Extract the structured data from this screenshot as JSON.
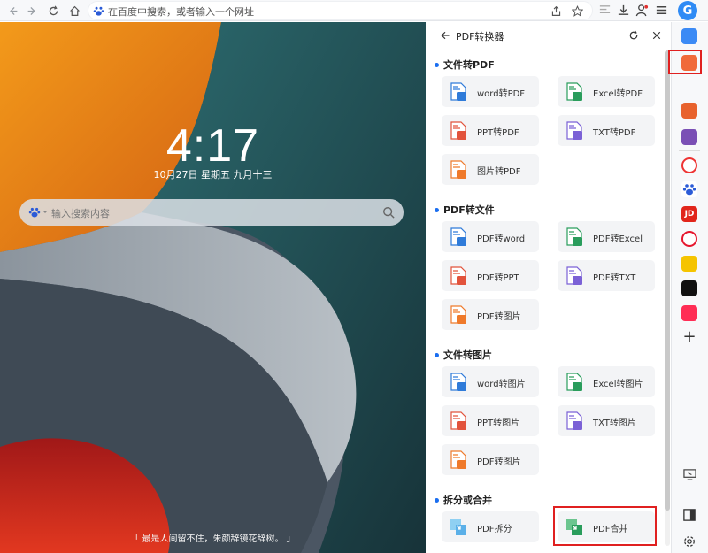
{
  "toolbar": {
    "address_placeholder": "在百度中搜索，或者输入一个网址"
  },
  "newtab": {
    "time": "4:17",
    "date": "10月27日 星期五 九月十三",
    "search_placeholder": "输入搜索内容",
    "quote": "「 最是人间留不住，朱颜辞镜花辞树。 」"
  },
  "panel": {
    "title": "PDF转换器",
    "sections": [
      {
        "title": "文件转PDF",
        "items": [
          "word转PDF",
          "Excel转PDF",
          "PPT转PDF",
          "TXT转PDF",
          "图片转PDF"
        ]
      },
      {
        "title": "PDF转文件",
        "items": [
          "PDF转word",
          "PDF转Excel",
          "PDF转PPT",
          "PDF转TXT",
          "PDF转图片"
        ]
      },
      {
        "title": "文件转图片",
        "items": [
          "word转图片",
          "Excel转图片",
          "PPT转图片",
          "TXT转图片",
          "PDF转图片"
        ]
      },
      {
        "title": "拆分或合并",
        "items": [
          "PDF拆分",
          "PDF合并"
        ]
      }
    ]
  },
  "sidebar": {
    "jd_label": "JD",
    "plus_label": "+"
  },
  "colors": {
    "accent": "#1a6ef0",
    "highlight": "#e02020",
    "word": "#2f7bd9",
    "excel": "#2a9d5c",
    "ppt": "#e2533c",
    "txt": "#7b61d6",
    "image": "#ef7a2b"
  }
}
